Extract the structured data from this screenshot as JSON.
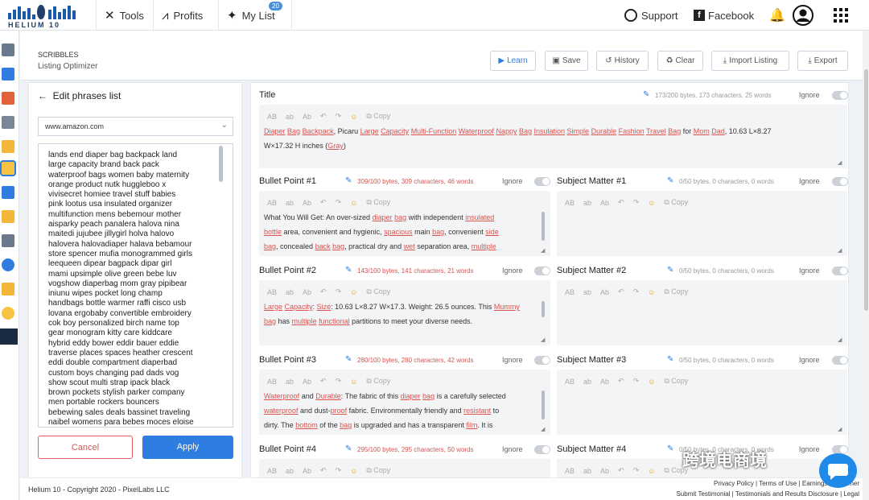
{
  "brand": {
    "name": "HELIUM 10"
  },
  "nav": {
    "tools": "Tools",
    "profits": "Profits",
    "mylist": "My List",
    "mylist_badge": "20",
    "support": "Support",
    "facebook": "Facebook"
  },
  "page": {
    "section": "SCRIBBLES",
    "tool": "Listing Optimizer"
  },
  "toolbar": {
    "learn": "Learn",
    "save": "Save",
    "history": "History",
    "clear": "Clear",
    "import": "Import Listing",
    "export": "Export"
  },
  "left": {
    "heading": "Edit phrases list",
    "marketplace": "www.amazon.com",
    "phrases": [
      "lands end diaper bag backpack land",
      "large capacity brand back pack",
      "waterproof bags women baby maternity",
      "orange product nutk huggleboo x",
      "vivisecret homiee travel stuff babies",
      "pink lootus usa insulated organizer",
      "multifunction mens bebemour mother",
      "aisparky peach panalera halova nina",
      "maitedi jujubee jillygirl holva halovo",
      "halovera halovadiaper halava bebamour",
      "store spencer mufia monogrammed girls",
      "leequeen dipear bagpack dipar girl",
      "mami upsimple olive green bebe luv",
      "vogshow diaperbag mom gray pipibear",
      "iniunu wipes pocket long champ",
      "handbags bottle warmer raffi cisco usb",
      "lovana ergobaby convertible embroidery",
      "cok boy personalized birch name top",
      "gear monogram kitty care kiddcare",
      "hybrid eddy bower eddir bauer eddie",
      "traverse places spaces heather crescent",
      "eddi double compartment diaperbad",
      "custom boys changing pad dads vog",
      "show scout multi strap ipack black",
      "brown pockets stylish parker company",
      "men portable rockers bouncers",
      "bebewing sales deals bassinet traveling",
      "naibel womens para bebes moces eloise"
    ],
    "cancel": "Cancel",
    "apply": "Apply"
  },
  "editor": {
    "toolbar_items": [
      "AB",
      "ab",
      "Ab",
      "↶",
      "↷",
      "☺",
      "Copy"
    ],
    "ignore_label": "Ignore",
    "title_label": "Title",
    "title_stat": "173/200 bytes, 173 characters, 25 words",
    "title_text": [
      [
        [
          "Diaper",
          1
        ],
        " ",
        [
          "Bag",
          1
        ],
        " ",
        [
          "Backpack",
          1
        ],
        ", Picaru ",
        [
          "Large",
          1
        ],
        " ",
        [
          "Capacity",
          1
        ],
        " ",
        [
          "Multi-Function",
          1
        ],
        " ",
        [
          "Waterproof",
          1
        ],
        " ",
        [
          "Nappy",
          1
        ],
        " ",
        [
          "Bag",
          1
        ],
        " ",
        [
          "Insulation",
          1
        ],
        " ",
        [
          "Simple",
          1
        ],
        " ",
        [
          "Durable",
          1
        ],
        " ",
        [
          "Fashion",
          1
        ],
        " ",
        [
          "Travel",
          1
        ],
        " ",
        [
          "Bag",
          1
        ],
        " for ",
        [
          "Mom",
          1
        ],
        " ",
        [
          "Dad",
          1
        ],
        ", 10.63 L×8.27"
      ],
      [
        "W×17.32 H inches (",
        [
          "Gray",
          1
        ],
        ")"
      ]
    ],
    "bullets": [
      {
        "label": "Bullet Point #1",
        "stat": "309/100 bytes, 309 characters, 46 words",
        "lines": [
          [
            "What You Will Get: An over-sized ",
            [
              "diaper",
              1
            ],
            " ",
            [
              "bag",
              1
            ],
            " with independent ",
            [
              "insulated",
              1
            ]
          ],
          [
            [
              "bottle",
              1
            ],
            " area, convenient and hygienic, ",
            [
              "spacious",
              1
            ],
            " main ",
            [
              "bag",
              1
            ],
            ", convenient ",
            [
              "side",
              1
            ]
          ],
          [
            [
              "bag",
              1
            ],
            ", concealed ",
            [
              "back",
              1
            ],
            " ",
            [
              "bag",
              1
            ],
            ", practical dry and ",
            [
              "wet",
              1
            ],
            " separation area, ",
            [
              "multiple",
              1
            ]
          ]
        ]
      },
      {
        "label": "Bullet Point #2",
        "stat": "143/100 bytes, 141 characters, 21 words",
        "lines": [
          [
            [
              "Large",
              1
            ],
            " ",
            [
              "Capacity",
              1
            ],
            ": ",
            [
              "Size",
              1
            ],
            ": 10.63 L×8.27 W×17.3. Weight: 26.5 ounces. This ",
            [
              "Mummy",
              1
            ]
          ],
          [
            [
              "bag",
              1
            ],
            " has ",
            [
              "multiple",
              1
            ],
            " ",
            [
              "functional",
              1
            ],
            " partitions to meet your diverse needs."
          ]
        ]
      },
      {
        "label": "Bullet Point #3",
        "stat": "280/100 bytes, 280 characters, 42 words",
        "lines": [
          [
            [
              "Waterproof",
              1
            ],
            " and ",
            [
              "Durable",
              1
            ],
            ": The fabric of this ",
            [
              "diaper",
              1
            ],
            " ",
            [
              "bag",
              1
            ],
            " is a carefully selected"
          ],
          [
            [
              "waterproof",
              1
            ],
            " and dust-",
            [
              "proof",
              1
            ],
            " fabric. Environmentally friendly and ",
            [
              "resistant",
              1
            ],
            " to"
          ],
          [
            "dirty. The ",
            [
              "bottom",
              1
            ],
            " of the ",
            [
              "bag",
              1
            ],
            " is upgraded and has a transparent ",
            [
              "film",
              1
            ],
            ". It is"
          ]
        ]
      },
      {
        "label": "Bullet Point #4",
        "stat": "295/100 bytes, 295 characters, 50 words",
        "lines": []
      }
    ],
    "subjects": [
      {
        "label": "Subject Matter #1",
        "stat": "0/50 bytes, 0 characters, 0 words"
      },
      {
        "label": "Subject Matter #2",
        "stat": "0/50 bytes, 0 characters, 0 words"
      },
      {
        "label": "Subject Matter #3",
        "stat": "0/50 bytes, 0 characters, 0 words"
      },
      {
        "label": "Subject Matter #4",
        "stat": "0/50 bytes, 0 characters, 0 words"
      }
    ]
  },
  "footer": {
    "copyright": "Helium 10 - Copyright 2020 - PixelLabs LLC",
    "links1": "Privacy Policy | Terms of Use | Earnings Disclaimer",
    "links2": "Submit Testimonial | Testimonials and Results Disclosure | Legal"
  },
  "watermark": "跨境电商境"
}
